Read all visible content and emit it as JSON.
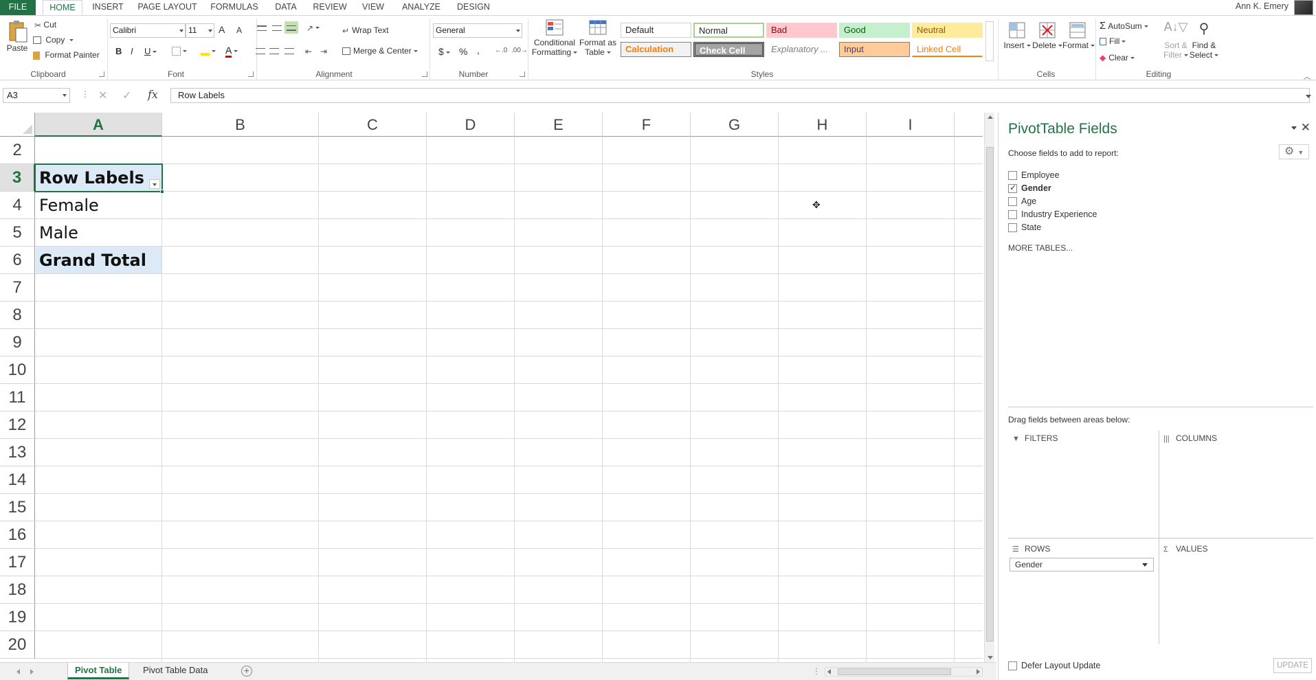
{
  "tabs": [
    {
      "label": "FILE"
    },
    {
      "label": "HOME"
    },
    {
      "label": "INSERT"
    },
    {
      "label": "PAGE LAYOUT"
    },
    {
      "label": "FORMULAS"
    },
    {
      "label": "DATA"
    },
    {
      "label": "REVIEW"
    },
    {
      "label": "VIEW"
    },
    {
      "label": "ANALYZE"
    },
    {
      "label": "DESIGN"
    }
  ],
  "user": {
    "name": "Ann K. Emery"
  },
  "ribbon": {
    "clipboard": {
      "paste": "Paste",
      "cut": "Cut",
      "copy": "Copy",
      "format_painter": "Format Painter",
      "label": "Clipboard"
    },
    "font": {
      "name": "Calibri",
      "size": "11",
      "bold": "B",
      "italic": "I",
      "underline": "U",
      "grow": "A",
      "shrink": "A",
      "font_color": "A",
      "label": "Font"
    },
    "alignment": {
      "wrap": "Wrap Text",
      "merge": "Merge & Center",
      "label": "Alignment"
    },
    "number": {
      "format": "General",
      "currency": "$",
      "percent": "%",
      "comma": ",",
      "label": "Number"
    },
    "styles": {
      "conditional_1": "Conditional",
      "conditional_2": "Formatting",
      "format_table_1": "Format as",
      "format_table_2": "Table",
      "label": "Styles",
      "cells": [
        {
          "label": "Default"
        },
        {
          "label": "Normal"
        },
        {
          "label": "Bad"
        },
        {
          "label": "Good"
        },
        {
          "label": "Neutral"
        },
        {
          "label": "Calculation"
        },
        {
          "label": "Check Cell"
        },
        {
          "label": "Explanatory ..."
        },
        {
          "label": "Input"
        },
        {
          "label": "Linked Cell"
        }
      ]
    },
    "cells": {
      "insert": "Insert",
      "delete": "Delete",
      "format": "Format",
      "label": "Cells"
    },
    "editing": {
      "autosum": "AutoSum",
      "fill": "Fill",
      "clear": "Clear",
      "sort_1": "Sort &",
      "sort_2": "Filter",
      "find_1": "Find &",
      "find_2": "Select",
      "label": "Editing"
    }
  },
  "formula_bar": {
    "name_box": "A3",
    "fx": "fx",
    "content": "Row Labels"
  },
  "grid": {
    "columns": [
      "A",
      "B",
      "C",
      "D",
      "E",
      "F",
      "G",
      "H",
      "I"
    ],
    "rows": [
      "2",
      "3",
      "4",
      "5",
      "6",
      "7",
      "8",
      "9",
      "10",
      "11",
      "12",
      "13",
      "14",
      "15",
      "16",
      "17",
      "18",
      "19",
      "20"
    ],
    "cells": {
      "a3": "Row Labels",
      "a4": "Female",
      "a5": "Male",
      "a6": "Grand Total"
    }
  },
  "sheets": [
    {
      "label": "Pivot Table"
    },
    {
      "label": "Pivot Table Data"
    }
  ],
  "pivot": {
    "title": "PivotTable Fields",
    "subtitle": "Choose fields to add to report:",
    "fields": [
      {
        "label": "Employee",
        "checked": false
      },
      {
        "label": "Gender",
        "checked": true
      },
      {
        "label": "Age",
        "checked": false
      },
      {
        "label": "Industry Experience",
        "checked": false
      },
      {
        "label": "State",
        "checked": false
      }
    ],
    "more_tables": "MORE TABLES...",
    "drag_label": "Drag fields between areas below:",
    "areas": {
      "filters": "FILTERS",
      "columns": "COLUMNS",
      "rows": "ROWS",
      "values": "VALUES"
    },
    "rows_item": "Gender",
    "defer": "Defer Layout Update",
    "update": "UPDATE"
  },
  "colors": {
    "accent": "#217346",
    "selection_fill": "#dce9f6"
  }
}
